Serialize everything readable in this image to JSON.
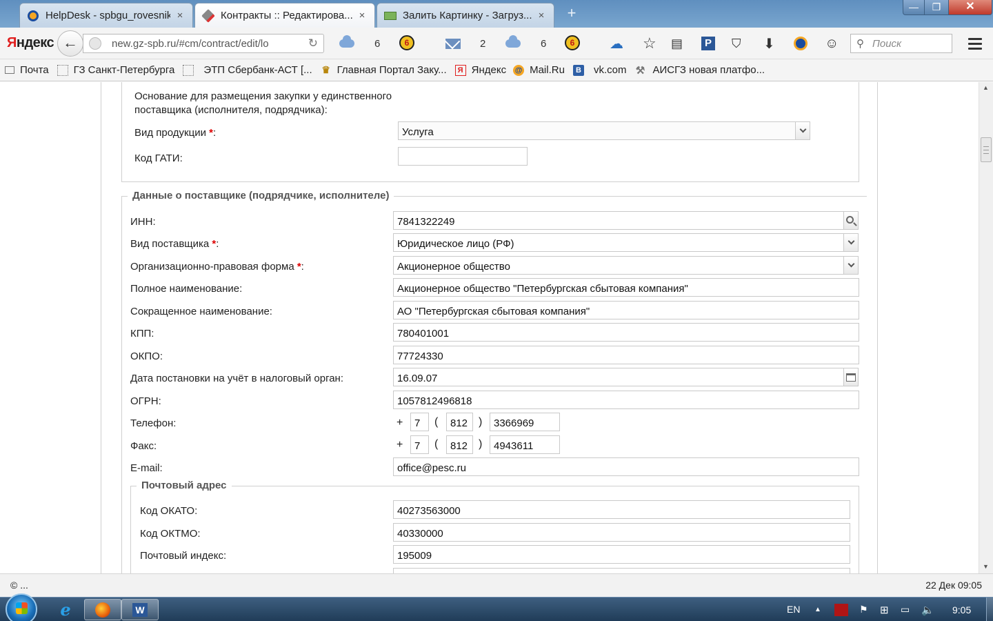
{
  "browser": {
    "tabs": [
      {
        "title": "HelpDesk - spbgu_rovesnik...",
        "active": false
      },
      {
        "title": "Контракты :: Редактирова...",
        "active": true
      },
      {
        "title": "Залить Картинку - Загруз...",
        "active": false
      }
    ],
    "tab_close_glyph": "×",
    "new_tab_glyph": "+",
    "window_controls": {
      "minimize": "—",
      "maximize": "❐",
      "close": "✕"
    },
    "logo_first": "Я",
    "logo_rest": "ндекс",
    "url": "new.gz-spb.ru/#cm/contract/edit/lo",
    "toolbar_counts": {
      "cloud_a": "6",
      "mail": "2",
      "cloud_b": "6",
      "coin": "6"
    },
    "search_placeholder": "Поиск",
    "bookmarks": [
      {
        "label": "Почта",
        "icon": "envelope-icon"
      },
      {
        "label": "ГЗ Санкт-Петербурга",
        "icon": "page-icon"
      },
      {
        "label": "ЭТП Сбербанк-АСТ [...",
        "icon": "page-icon"
      },
      {
        "label": "Главная Портал Заку...",
        "icon": "emblem-icon"
      },
      {
        "label": "Яндекс",
        "icon": "yandex-icon"
      },
      {
        "label": "Mail.Ru",
        "icon": "mailru-icon"
      },
      {
        "label": "vk.com",
        "icon": "vk-icon"
      },
      {
        "label": "АИСГЗ новая платфо...",
        "icon": "tools-icon"
      }
    ]
  },
  "form": {
    "top_section": {
      "basis_label_line1": "Основание для размещения закупки у единственного",
      "basis_label_line2": "поставщика (исполнителя, подрядчика):",
      "product_type_label": "Вид продукции",
      "product_type_value": "Услуга",
      "gati_code_label": "Код ГАТИ:",
      "gati_code_value": ""
    },
    "required_mark": "*",
    "colon": ":",
    "supplier": {
      "legend": "Данные о поставщике (подрядчике, исполнителе)",
      "inn_label": "ИНН:",
      "inn_value": "7841322249",
      "supplier_type_label": "Вид поставщика",
      "supplier_type_value": "Юридическое лицо (РФ)",
      "legal_form_label": "Организационно-правовая форма",
      "legal_form_value": "Акционерное общество",
      "full_name_label": "Полное наименование:",
      "full_name_value": "Акционерное общество \"Петербургская сбытовая компания\"",
      "short_name_label": "Сокращенное наименование:",
      "short_name_value": "АО \"Петербургская сбытовая компания\"",
      "kpp_label": "КПП:",
      "kpp_value": "780401001",
      "okpo_label": "ОКПО:",
      "okpo_value": "77724330",
      "tax_date_label": "Дата постановки на учёт в налоговый орган:",
      "tax_date_value": "16.09.07",
      "ogrn_label": "ОГРН:",
      "ogrn_value": "1057812496818",
      "phone_label": "Телефон:",
      "phone": {
        "country": "7",
        "area": "812",
        "number": "3366969"
      },
      "fax_label": "Факс:",
      "fax": {
        "country": "7",
        "area": "812",
        "number": "4943611"
      },
      "plus": "+",
      "paren_open": "(",
      "paren_close": ")",
      "email_label": "E-mail:",
      "email_value": "office@pesc.ru"
    },
    "postal": {
      "legend": "Почтовый адрес",
      "okato_label": "Код ОКАТО:",
      "okato_value": "40273563000",
      "oktmo_label": "Код ОКТМО:",
      "oktmo_value": "40330000",
      "index_label": "Почтовый индекс:",
      "index_value": "195009"
    }
  },
  "statusbar": {
    "left": "© ...",
    "right": "22 Дек 09:05"
  },
  "taskbar": {
    "lang": "EN",
    "time": "9:05",
    "word_letter": "W",
    "ie_letter": "e"
  }
}
